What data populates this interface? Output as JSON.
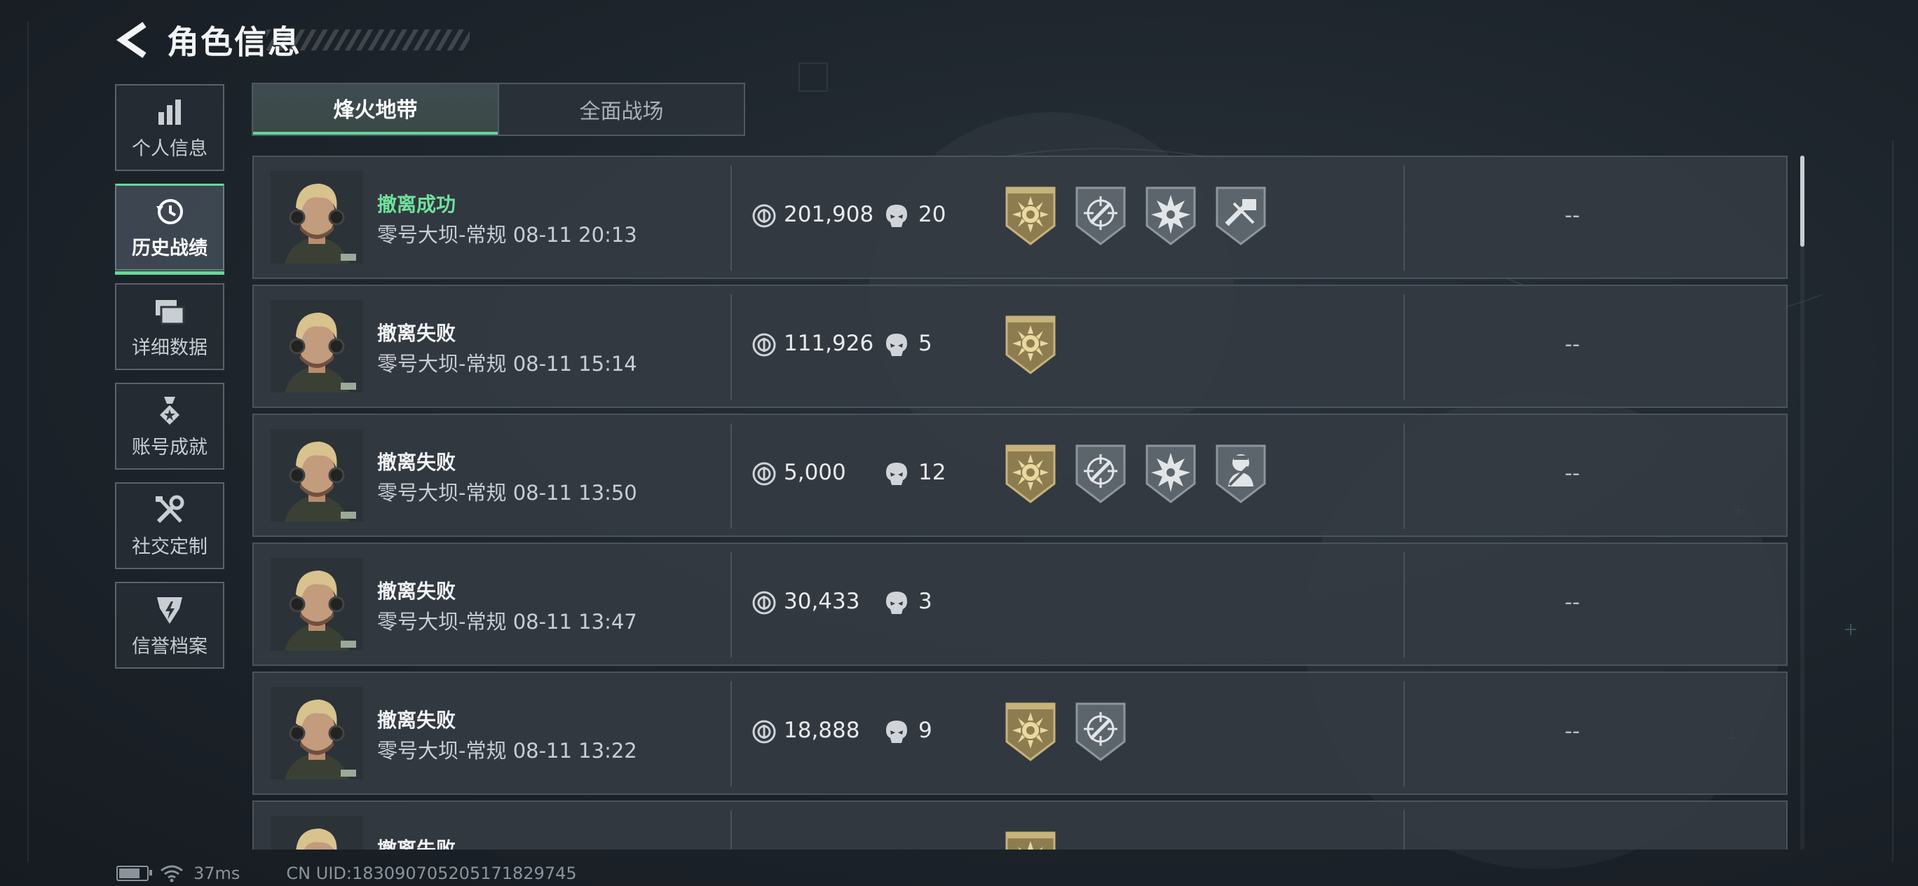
{
  "header": {
    "title": "角色信息"
  },
  "nav": {
    "items": [
      {
        "label": "个人信息",
        "icon": "bar-chart-icon"
      },
      {
        "label": "历史战绩",
        "icon": "history-clock-icon",
        "active": true
      },
      {
        "label": "详细数据",
        "icon": "folder-icon"
      },
      {
        "label": "账号成就",
        "icon": "medal-icon"
      },
      {
        "label": "社交定制",
        "icon": "tools-icon"
      },
      {
        "label": "信誉档案",
        "icon": "shield-icon"
      }
    ]
  },
  "tabs": [
    {
      "label": "烽火地带",
      "active": true
    },
    {
      "label": "全面战场",
      "active": false
    }
  ],
  "matches": [
    {
      "result": "撤离成功",
      "success": true,
      "map": "零号大坝-常规",
      "time": "08-11 20:13",
      "value": "201,908",
      "kills": "20",
      "medals": [
        "gold-sun-medal-icon",
        "crosshair-medal-icon",
        "explosion-medal-icon",
        "tools-medal-icon"
      ],
      "extra": "--"
    },
    {
      "result": "撤离失败",
      "success": false,
      "map": "零号大坝-常规",
      "time": "08-11 15:14",
      "value": "111,926",
      "kills": "5",
      "medals": [
        "gold-sun-medal-icon"
      ],
      "extra": "--"
    },
    {
      "result": "撤离失败",
      "success": false,
      "map": "零号大坝-常规",
      "time": "08-11 13:50",
      "value": "5,000",
      "kills": "12",
      "medals": [
        "gold-sun-medal-icon",
        "crosshair-medal-icon",
        "explosion-medal-icon",
        "medic-medal-icon"
      ],
      "extra": "--"
    },
    {
      "result": "撤离失败",
      "success": false,
      "map": "零号大坝-常规",
      "time": "08-11 13:47",
      "value": "30,433",
      "kills": "3",
      "medals": [],
      "extra": "--"
    },
    {
      "result": "撤离失败",
      "success": false,
      "map": "零号大坝-常规",
      "time": "08-11 13:22",
      "value": "18,888",
      "kills": "9",
      "medals": [
        "gold-sun-medal-icon",
        "crosshair-medal-icon"
      ],
      "extra": "--"
    },
    {
      "result": "撤离失败",
      "success": false,
      "map": "",
      "time": "",
      "value": "",
      "kills": "",
      "medals": [
        "gold-sun-medal-icon"
      ],
      "extra": ""
    }
  ],
  "footer": {
    "ping": "37ms",
    "uid": "CN UID:18309070520517182​9745"
  },
  "colors": {
    "accent": "#68d59a",
    "success": "#6fe19d",
    "gold": "#c7b27a"
  }
}
